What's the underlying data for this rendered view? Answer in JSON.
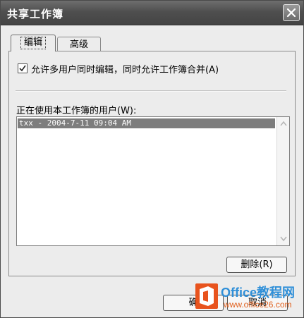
{
  "window": {
    "title": "共享工作簿",
    "close_icon": "close-icon"
  },
  "tabs": [
    {
      "label": "编辑",
      "selected": true
    },
    {
      "label": "高级",
      "selected": false
    }
  ],
  "edit": {
    "allow_multi_user_label": "允许多用户同时编辑，同时允许工作簿合并(A)",
    "allow_multi_user_checked": true,
    "users_label": "正在使用本工作簿的用户(W):",
    "users": [
      "txx - 2004-7-11 09:04 AM"
    ],
    "delete_button": "删除(R)"
  },
  "footer": {
    "ok_button": "确",
    "cancel_button": "取消"
  },
  "watermark": {
    "brand": "Office教程网",
    "url": "www.office26.com"
  }
}
